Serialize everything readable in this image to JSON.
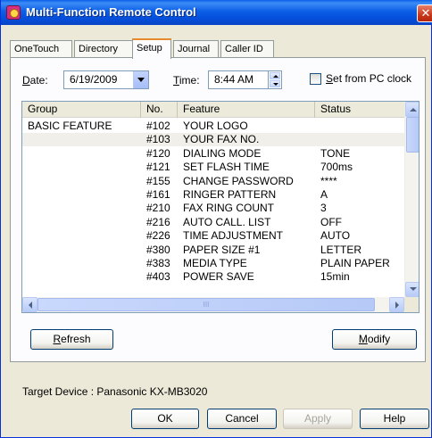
{
  "window": {
    "title": "Multi-Function Remote Control",
    "close_glyph": "✕",
    "title_icon": "app-icon"
  },
  "tabs": [
    {
      "label": "OneTouch",
      "active": false
    },
    {
      "label": "Directory",
      "active": false
    },
    {
      "label": "Setup",
      "active": true
    },
    {
      "label": "Journal",
      "active": false
    },
    {
      "label": "Caller ID",
      "active": false
    }
  ],
  "setup": {
    "date_label": "ate:",
    "date_label_mnemonic": "D",
    "date_value": "6/19/2009",
    "time_label": "ime:",
    "time_label_mnemonic": "T",
    "time_value": "8:44 AM",
    "set_from_pc_mnemonic": "S",
    "set_from_pc_label": "et from PC clock",
    "set_from_pc_checked": false
  },
  "table": {
    "columns": [
      "Group",
      "No.",
      "Feature",
      "Status"
    ],
    "rows": [
      {
        "group": "BASIC FEATURE",
        "no": "#102",
        "feature": "YOUR LOGO",
        "status": ""
      },
      {
        "group": "",
        "no": "#103",
        "feature": "YOUR FAX NO.",
        "status": ""
      },
      {
        "group": "",
        "no": "#120",
        "feature": "DIALING MODE",
        "status": "TONE"
      },
      {
        "group": "",
        "no": "#121",
        "feature": "SET FLASH TIME",
        "status": "700ms"
      },
      {
        "group": "",
        "no": "#155",
        "feature": "CHANGE PASSWORD",
        "status": "****"
      },
      {
        "group": "",
        "no": "#161",
        "feature": "RINGER PATTERN",
        "status": "A"
      },
      {
        "group": "",
        "no": "#210",
        "feature": "FAX RING COUNT",
        "status": "3"
      },
      {
        "group": "",
        "no": "#216",
        "feature": "AUTO CALL. LIST",
        "status": "OFF"
      },
      {
        "group": "",
        "no": "#226",
        "feature": "TIME ADJUSTMENT",
        "status": "AUTO"
      },
      {
        "group": "",
        "no": "#380",
        "feature": "PAPER SIZE #1",
        "status": "LETTER"
      },
      {
        "group": "",
        "no": "#383",
        "feature": "MEDIA TYPE",
        "status": "PLAIN PAPER"
      },
      {
        "group": "",
        "no": "#403",
        "feature": "POWER SAVE",
        "status": "15min"
      }
    ],
    "selected_row": 1,
    "hscroll_grip": "III"
  },
  "buttons": {
    "refresh_mnemonic": "R",
    "refresh_rest": "efresh",
    "modify_mnemonic": "M",
    "modify_rest": "odify",
    "ok": "OK",
    "cancel": "Cancel",
    "apply": "Apply",
    "help": "Help"
  },
  "status": {
    "target_device": "Target Device : Panasonic KX-MB3020"
  }
}
